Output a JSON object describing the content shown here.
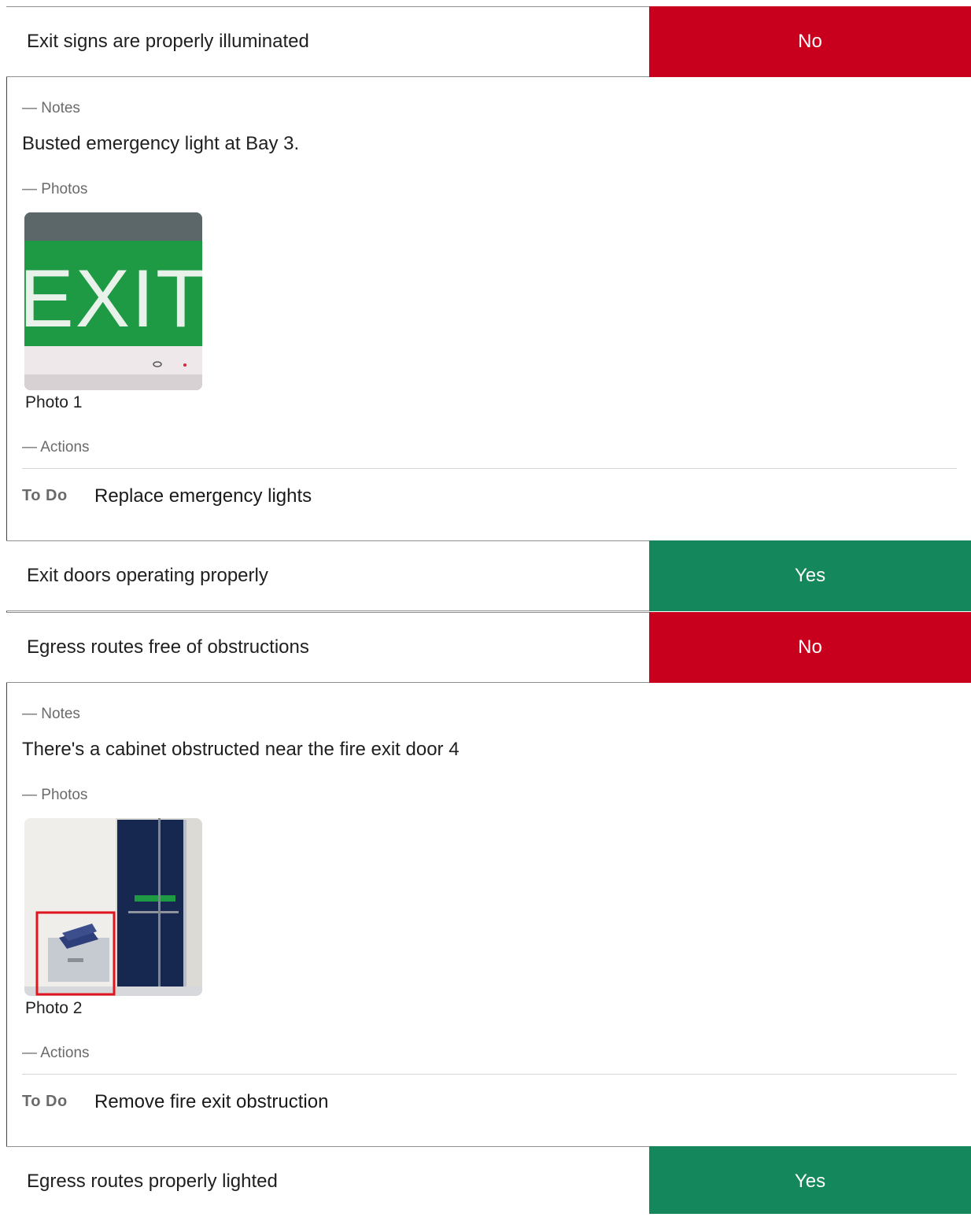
{
  "items": [
    {
      "question": "Exit signs are properly illuminated",
      "answer": "No"
    },
    {
      "question": "Exit doors operating properly",
      "answer": "Yes"
    },
    {
      "question": "Egress routes free of obstructions",
      "answer": "No"
    },
    {
      "question": "Egress routes properly lighted",
      "answer": "Yes"
    }
  ],
  "details": [
    {
      "notes_label": "— Notes",
      "note": "Busted emergency light at Bay 3.",
      "photos_label": "— Photos",
      "photo_caption": "Photo 1",
      "photo_text": "EXIT",
      "actions_label": "— Actions",
      "action_status": "To Do",
      "action_title": "Replace emergency lights"
    },
    {
      "notes_label": "— Notes",
      "note": "There's a cabinet obstructed near the fire exit door 4",
      "photos_label": "— Photos",
      "photo_caption": "Photo 2",
      "actions_label": "— Actions",
      "action_status": "To Do",
      "action_title": "Remove fire exit obstruction"
    }
  ],
  "colors": {
    "no": "#c8001e",
    "yes": "#14875c"
  }
}
